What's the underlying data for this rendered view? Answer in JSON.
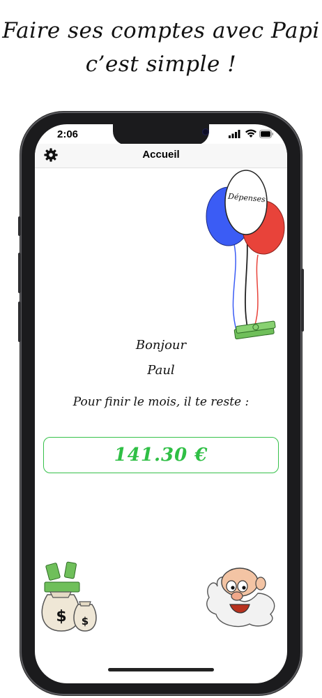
{
  "headline": {
    "line1": "Faire ses comptes avec Papi",
    "line2": "c’est simple !"
  },
  "status_bar": {
    "time": "2:06"
  },
  "nav": {
    "title": "Accueil",
    "settings_icon": "gear-icon"
  },
  "balloons": {
    "label": "Dépenses",
    "colors": {
      "blue": "#3b5cf5",
      "red": "#e8433a",
      "white": "#ffffff"
    }
  },
  "main": {
    "greeting": "Bonjour",
    "user_name": "Paul",
    "remaining_label": "Pour finir le mois, il te reste :",
    "amount": "141.30 €"
  },
  "colors": {
    "accent_green": "#2fbf45",
    "nav_background": "#f7f7f7"
  }
}
